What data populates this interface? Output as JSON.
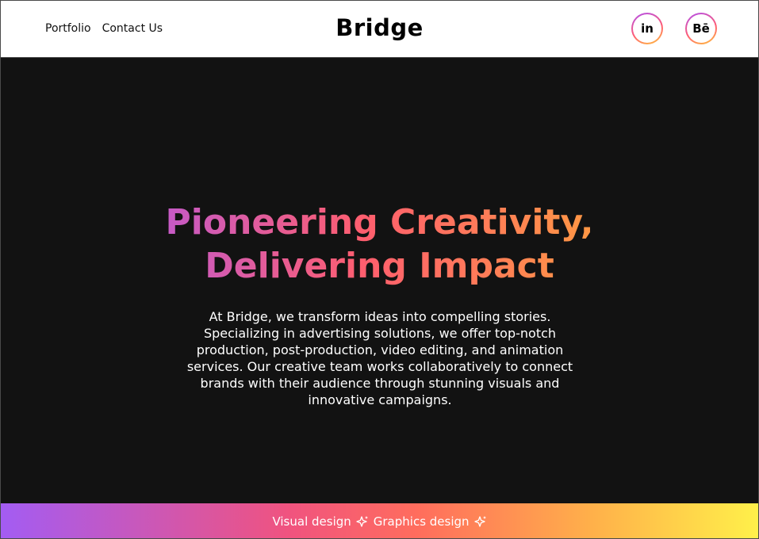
{
  "header": {
    "nav": [
      {
        "label": "Portfolio"
      },
      {
        "label": "Contact Us"
      }
    ],
    "brand": "Bridge",
    "social": [
      {
        "label": "in",
        "icon": "linkedin-icon"
      },
      {
        "label": "Bē",
        "icon": "behance-icon"
      }
    ]
  },
  "hero": {
    "headline_line1": "Pioneering Creativity,",
    "headline_line2": "Delivering Impact",
    "description": "At Bridge, we transform ideas into compelling stories. Specializing in advertising solutions, we offer top-notch production, post-production, video editing, and animation services. Our creative team works collaboratively to connect brands with their audience through stunning visuals and innovative campaigns."
  },
  "ticker": {
    "items": [
      "Visual design",
      "Graphics design"
    ]
  },
  "colors": {
    "hero_background": "#121212",
    "gradient_start": "#a35cf3",
    "gradient_mid": "#ff5e6e",
    "gradient_end": "#fff04a"
  }
}
